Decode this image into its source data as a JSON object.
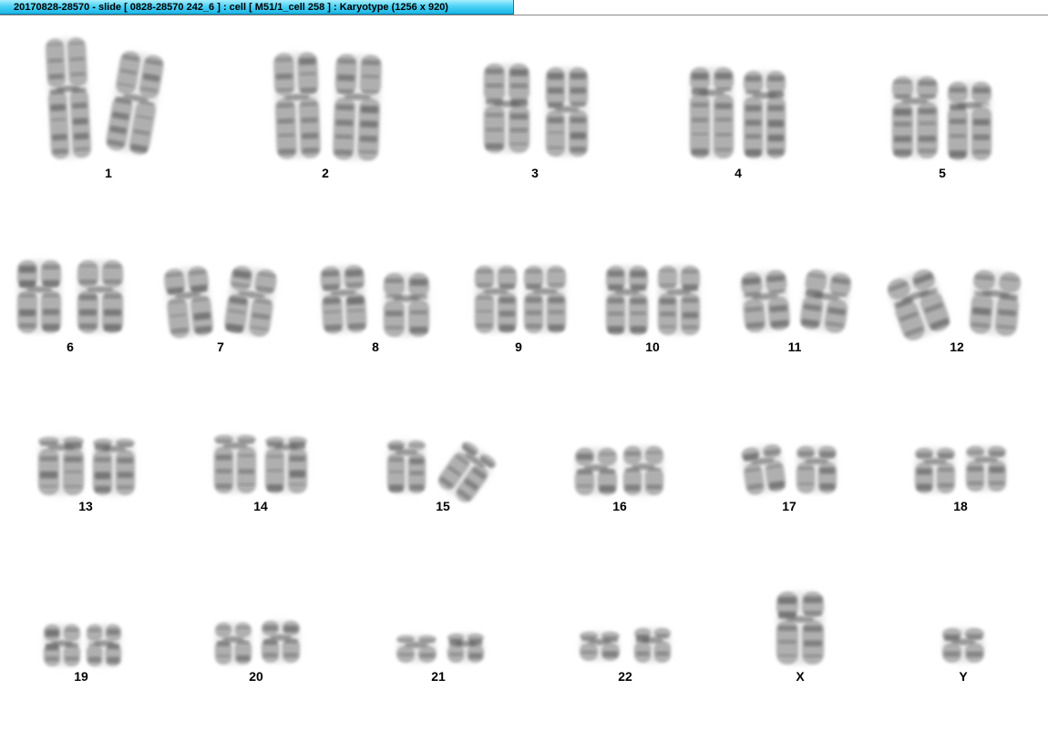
{
  "window": {
    "title": "20170828-28570 - slide [ 0828-28570 242_6 ] : cell [ M51/1_cell 258 ] : Karyotype  (1256 x 920)"
  },
  "karyotype": {
    "chromosomes": [
      {
        "id": "1",
        "label": "1"
      },
      {
        "id": "2",
        "label": "2"
      },
      {
        "id": "3",
        "label": "3"
      },
      {
        "id": "4",
        "label": "4"
      },
      {
        "id": "5",
        "label": "5"
      },
      {
        "id": "6",
        "label": "6"
      },
      {
        "id": "7",
        "label": "7"
      },
      {
        "id": "8",
        "label": "8"
      },
      {
        "id": "9",
        "label": "9"
      },
      {
        "id": "10",
        "label": "10"
      },
      {
        "id": "11",
        "label": "11"
      },
      {
        "id": "12",
        "label": "12"
      },
      {
        "id": "13",
        "label": "13"
      },
      {
        "id": "14",
        "label": "14"
      },
      {
        "id": "15",
        "label": "15"
      },
      {
        "id": "16",
        "label": "16"
      },
      {
        "id": "17",
        "label": "17"
      },
      {
        "id": "18",
        "label": "18"
      },
      {
        "id": "19",
        "label": "19"
      },
      {
        "id": "20",
        "label": "20"
      },
      {
        "id": "21",
        "label": "21"
      },
      {
        "id": "22",
        "label": "22"
      },
      {
        "id": "X",
        "label": "X"
      },
      {
        "id": "Y",
        "label": "Y"
      }
    ]
  },
  "colors": {
    "title_bar": "#4fd2f6",
    "chromatid_light": "#d2d2d2",
    "chromatid_mid": "#a6a6a6",
    "band_dark": "#5c5c5c"
  }
}
